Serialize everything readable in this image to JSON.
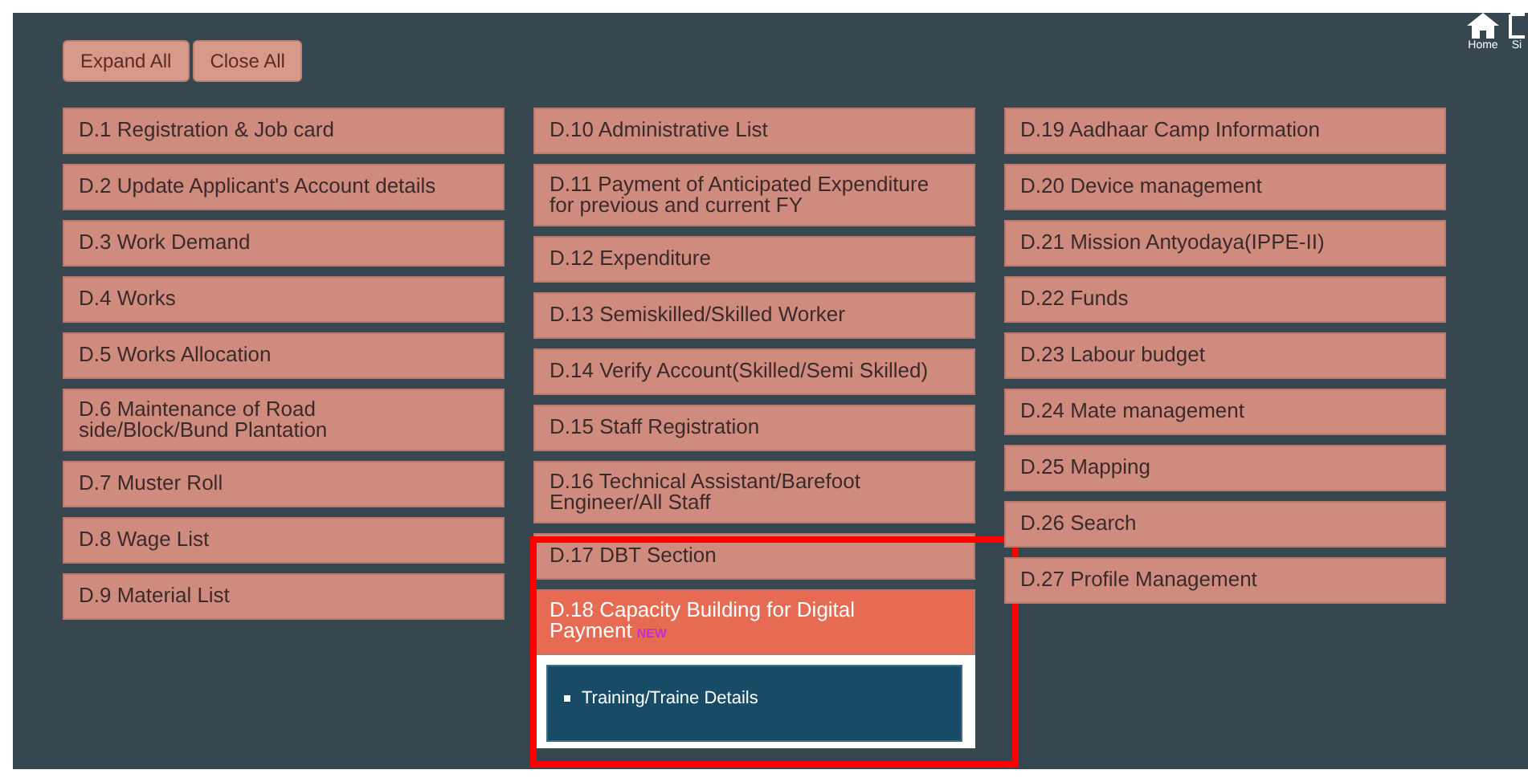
{
  "header": {
    "home_label": "Home",
    "second_label": "Si"
  },
  "toolbar": {
    "buttons": [
      "Expand All",
      "Close All"
    ]
  },
  "columns": [
    {
      "items": [
        {
          "label": "D.1 Registration & Job card",
          "expanded": false
        },
        {
          "label": "D.2 Update Applicant's Account details",
          "expanded": false
        },
        {
          "label": "D.3 Work Demand",
          "expanded": false
        },
        {
          "label": "D.4 Works",
          "expanded": false
        },
        {
          "label": "D.5 Works Allocation",
          "expanded": false
        },
        {
          "label": "D.6 Maintenance of Road side/Block/Bund Plantation",
          "expanded": false
        },
        {
          "label": "D.7 Muster Roll",
          "expanded": false
        },
        {
          "label": "D.8 Wage List",
          "expanded": false
        },
        {
          "label": "D.9 Material List",
          "expanded": false
        }
      ]
    },
    {
      "items": [
        {
          "label": "D.10 Administrative List",
          "expanded": false
        },
        {
          "label": "D.11 Payment of Anticipated Expenditure for previous and current FY",
          "expanded": false
        },
        {
          "label": "D.12 Expenditure",
          "expanded": false
        },
        {
          "label": "D.13 Semiskilled/Skilled Worker",
          "expanded": false
        },
        {
          "label": "D.14 Verify Account(Skilled/Semi Skilled)",
          "expanded": false
        },
        {
          "label": "D.15 Staff Registration",
          "expanded": false
        },
        {
          "label": "D.16 Technical Assistant/Barefoot Engineer/All Staff",
          "expanded": false
        },
        {
          "label": "D.17 DBT Section",
          "expanded": false
        },
        {
          "label": "D.18 Capacity Building for Digital Payment",
          "badge": "NEW",
          "expanded": true,
          "children": [
            "Training/Traine Details"
          ]
        }
      ]
    },
    {
      "items": [
        {
          "label": "D.19 Aadhaar Camp Information",
          "expanded": false
        },
        {
          "label": "D.20 Device management",
          "expanded": false
        },
        {
          "label": "D.21 Mission Antyodaya(IPPE-II)",
          "expanded": false
        },
        {
          "label": "D.22 Funds",
          "expanded": false
        },
        {
          "label": "D.23 Labour budget",
          "expanded": false
        },
        {
          "label": "D.24 Mate management",
          "expanded": false
        },
        {
          "label": "D.25 Mapping",
          "expanded": false
        },
        {
          "label": "D.26 Search",
          "expanded": false
        },
        {
          "label": "D.27 Profile Management",
          "expanded": false
        }
      ]
    }
  ]
}
